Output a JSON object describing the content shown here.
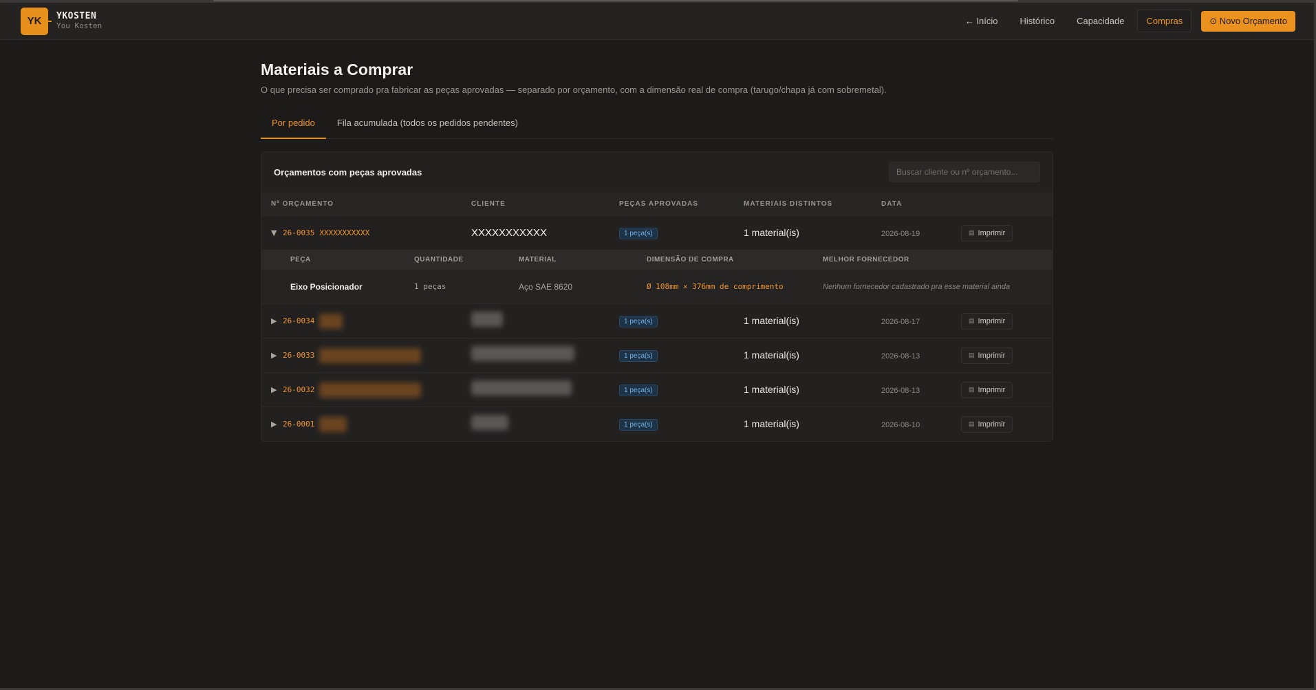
{
  "brand": {
    "logo": "YK",
    "name": "YKOSTEN",
    "subtitle": "You Kosten"
  },
  "nav": {
    "inicio": "← Início",
    "historico": "Histórico",
    "capacidade": "Capacidade",
    "compras": "Compras",
    "novo_orcamento": "⊙ Novo Orçamento"
  },
  "page": {
    "title": "Materiais a Comprar",
    "subtitle": "O que precisa ser comprado pra fabricar as peças aprovadas — separado por orçamento, com a dimensão real de compra (tarugo/chapa já com sobremetal)."
  },
  "tabs": [
    {
      "label": "Por pedido",
      "active": true
    },
    {
      "label": "Fila acumulada (todos os pedidos pendentes)",
      "active": false
    }
  ],
  "card": {
    "title": "Orçamentos com peças aprovadas",
    "search_placeholder": "Buscar cliente ou nº orçamento..."
  },
  "table": {
    "headers": [
      "Nº ORÇAMENTO",
      "CLIENTE",
      "PEÇAS APROVADAS",
      "MATERIAIS DISTINTOS",
      "DATA"
    ],
    "print_label": "Imprimir",
    "rows": [
      {
        "caret": "▼",
        "number": "26-0035",
        "number_suffix": "XXXXXXXXXXX",
        "client": "XXXXXXXXXXX",
        "pieces": "1 peça(s)",
        "materials": "1 material(is)",
        "date": "2026-08-19",
        "expanded": true
      },
      {
        "caret": "▶",
        "number": "26-0034",
        "pieces": "1 peça(s)",
        "materials": "1 material(is)",
        "date": "2026-08-17",
        "expanded": false
      },
      {
        "caret": "▶",
        "number": "26-0033",
        "pieces": "1 peça(s)",
        "materials": "1 material(is)",
        "date": "2026-08-13",
        "expanded": false
      },
      {
        "caret": "▶",
        "number": "26-0032",
        "pieces": "1 peça(s)",
        "materials": "1 material(is)",
        "date": "2026-08-13",
        "expanded": false
      },
      {
        "caret": "▶",
        "number": "26-0001",
        "pieces": "1 peça(s)",
        "materials": "1 material(is)",
        "date": "2026-08-10",
        "expanded": false
      }
    ]
  },
  "detail": {
    "headers": [
      "PEÇA",
      "QUANTIDADE",
      "MATERIAL",
      "DIMENSÃO DE COMPRA",
      "MELHOR FORNECEDOR"
    ],
    "row": {
      "piece": "Eixo Posicionador",
      "quantity": "1 peças",
      "material": "Aço SAE 8620",
      "dimension": "Ø 108mm × 376mm de comprimento",
      "supplier": "Nenhum fornecedor cadastrado pra esse material ainda"
    }
  },
  "colors": {
    "accent": "#eb921e",
    "background": "#1c1b1a",
    "badge_blue": "#6fb2e8"
  },
  "icons": {
    "print": "print-icon",
    "caret_down": "caret-down-icon",
    "caret_right": "caret-right-icon"
  }
}
